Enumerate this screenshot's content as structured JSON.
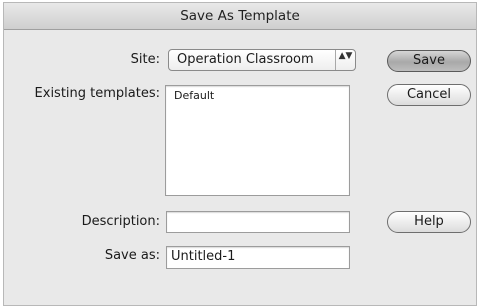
{
  "dialog": {
    "title": "Save As Template"
  },
  "site": {
    "label": "Site:",
    "selected": "Operation Classroom",
    "arrows_glyph": "▲▼"
  },
  "existing_templates": {
    "label": "Existing templates:",
    "items": [
      "Default"
    ]
  },
  "description": {
    "label": "Description:",
    "value": ""
  },
  "save_as": {
    "label": "Save as:",
    "value": "Untitled-1"
  },
  "buttons": {
    "save": "Save",
    "cancel": "Cancel",
    "help": "Help"
  }
}
